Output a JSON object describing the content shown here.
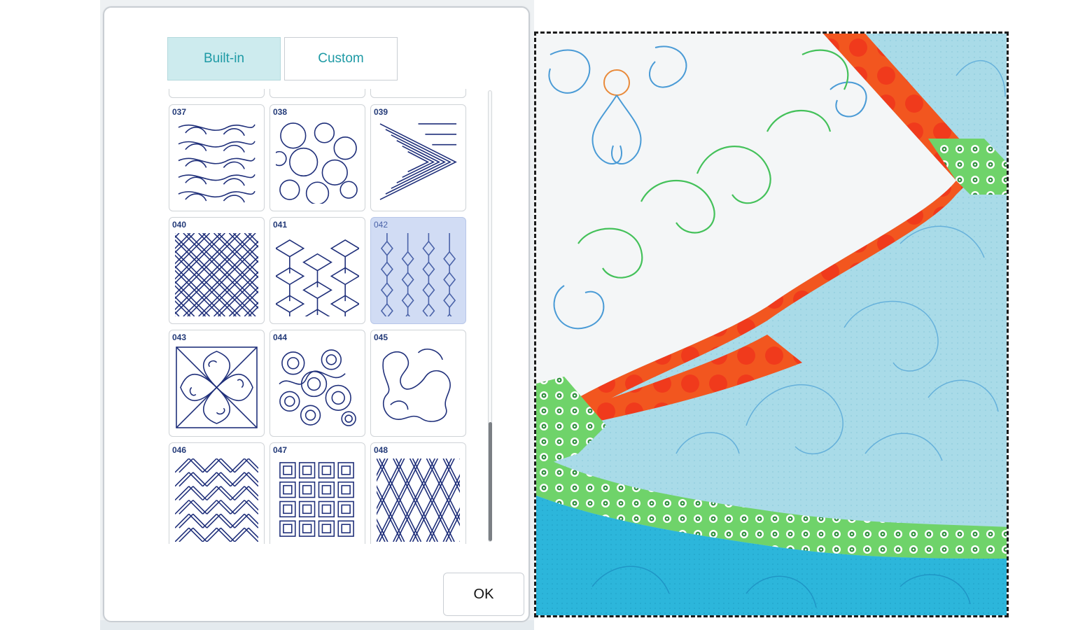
{
  "dialog": {
    "tabs": [
      {
        "label": "Built-in",
        "active": true
      },
      {
        "label": "Custom",
        "active": false
      }
    ],
    "ok_label": "OK",
    "patterns": [
      {
        "number": "037",
        "icon": "leaf-swirl-pattern-icon",
        "selected": false
      },
      {
        "number": "038",
        "icon": "circles-pattern-icon",
        "selected": false
      },
      {
        "number": "039",
        "icon": "angular-maze-pattern-icon",
        "selected": false
      },
      {
        "number": "040",
        "icon": "basket-weave-pattern-icon",
        "selected": false
      },
      {
        "number": "041",
        "icon": "tumbling-blocks-pattern-icon",
        "selected": false
      },
      {
        "number": "042",
        "icon": "diamond-chain-pattern-icon",
        "selected": true
      },
      {
        "number": "043",
        "icon": "feather-medallion-pattern-icon",
        "selected": false
      },
      {
        "number": "044",
        "icon": "loops-circles-pattern-icon",
        "selected": false
      },
      {
        "number": "045",
        "icon": "meander-pattern-icon",
        "selected": false
      },
      {
        "number": "046",
        "icon": "herringbone-pattern-icon",
        "selected": false
      },
      {
        "number": "047",
        "icon": "lattice-squares-pattern-icon",
        "selected": false
      },
      {
        "number": "048",
        "icon": "argyle-lattice-pattern-icon",
        "selected": false
      }
    ]
  },
  "colors": {
    "accent": "#1e9aa5",
    "tab_active_bg": "#cdebee",
    "selected_cell_bg": "#d1dcf4",
    "pattern_stroke": "#1f2f7a",
    "quilt_orange": "#f0471c",
    "quilt_green": "#6fd36a",
    "quilt_light_blue": "#a9dbe8",
    "quilt_bright_blue": "#2cb6db"
  },
  "preview": {
    "description_icon": "quilt-stitch-preview-image"
  }
}
